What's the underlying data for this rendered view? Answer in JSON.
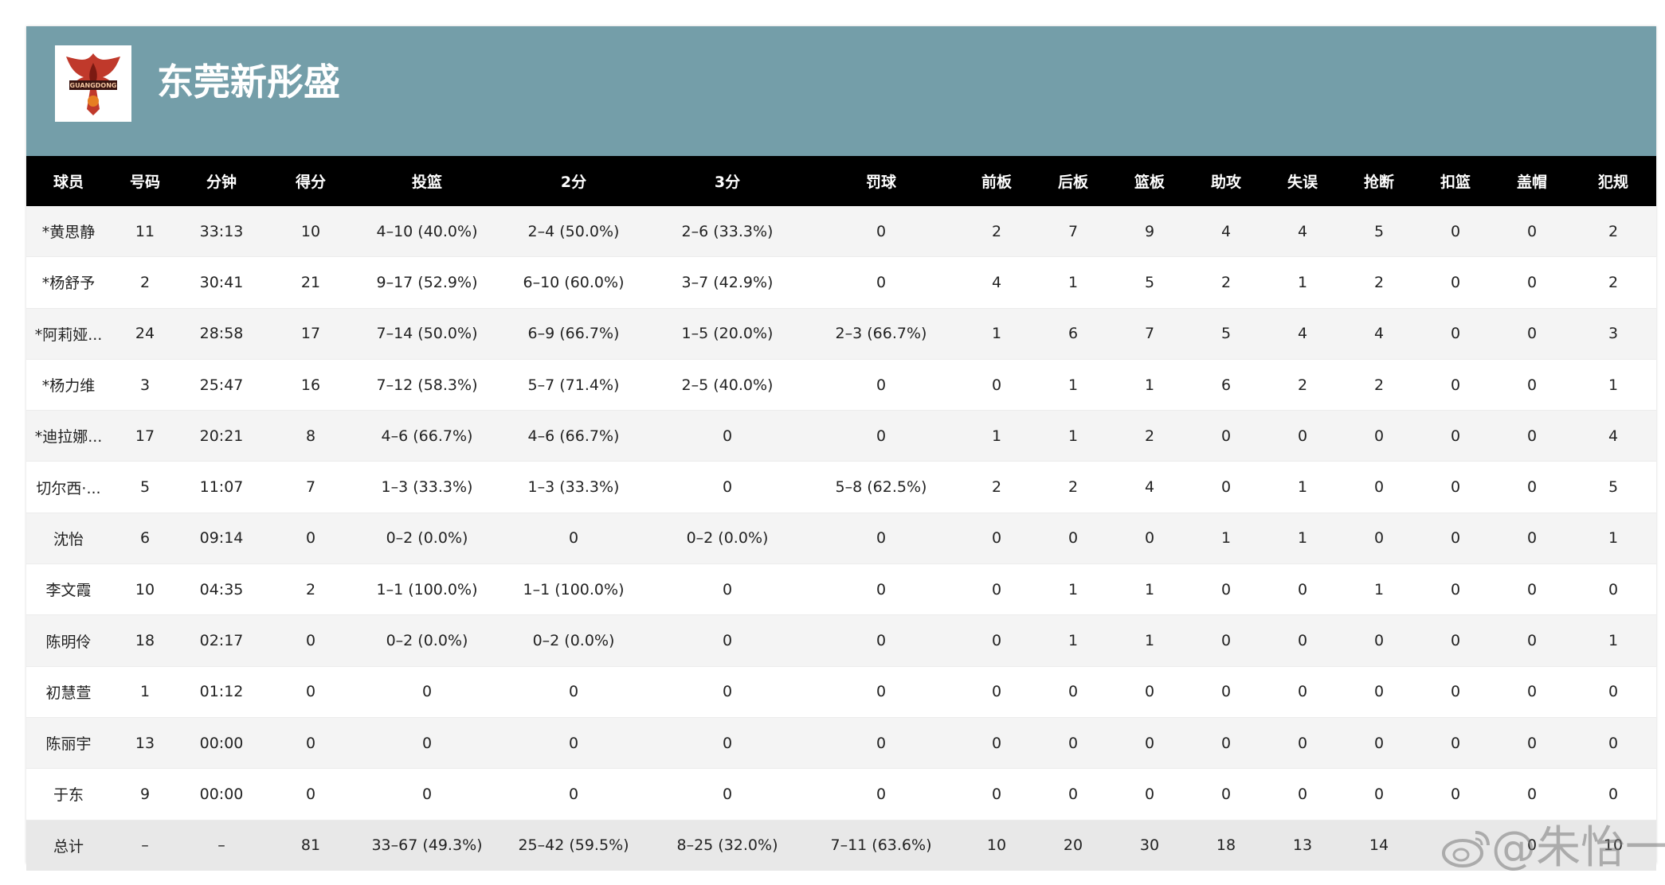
{
  "team": {
    "name": "东莞新彤盛",
    "logo_text": "GUANGDONG",
    "colors": {
      "header_bg": "#749ea9",
      "table_header_bg": "#000000",
      "logo_primary": "#c0392b"
    }
  },
  "table": {
    "columns": [
      "球员",
      "号码",
      "分钟",
      "得分",
      "投篮",
      "2分",
      "3分",
      "罚球",
      "前板",
      "后板",
      "篮板",
      "助攻",
      "失误",
      "抢断",
      "扣篮",
      "盖帽",
      "犯规"
    ],
    "rows": [
      [
        "*黄思静",
        "11",
        "33:13",
        "10",
        "4–10 (40.0%)",
        "2–4 (50.0%)",
        "2–6 (33.3%)",
        "0",
        "2",
        "7",
        "9",
        "4",
        "4",
        "5",
        "0",
        "0",
        "2"
      ],
      [
        "*杨舒予",
        "2",
        "30:41",
        "21",
        "9–17 (52.9%)",
        "6–10 (60.0%)",
        "3–7 (42.9%)",
        "0",
        "4",
        "1",
        "5",
        "2",
        "1",
        "2",
        "0",
        "0",
        "2"
      ],
      [
        "*阿莉娅...",
        "24",
        "28:58",
        "17",
        "7–14 (50.0%)",
        "6–9 (66.7%)",
        "1–5 (20.0%)",
        "2–3 (66.7%)",
        "1",
        "6",
        "7",
        "5",
        "4",
        "4",
        "0",
        "0",
        "3"
      ],
      [
        "*杨力维",
        "3",
        "25:47",
        "16",
        "7–12 (58.3%)",
        "5–7 (71.4%)",
        "2–5 (40.0%)",
        "0",
        "0",
        "1",
        "1",
        "6",
        "2",
        "2",
        "0",
        "0",
        "1"
      ],
      [
        "*迪拉娜...",
        "17",
        "20:21",
        "8",
        "4–6 (66.7%)",
        "4–6 (66.7%)",
        "0",
        "0",
        "1",
        "1",
        "2",
        "0",
        "0",
        "0",
        "0",
        "0",
        "4"
      ],
      [
        "切尔西·...",
        "5",
        "11:07",
        "7",
        "1–3 (33.3%)",
        "1–3 (33.3%)",
        "0",
        "5–8 (62.5%)",
        "2",
        "2",
        "4",
        "0",
        "1",
        "0",
        "0",
        "0",
        "5"
      ],
      [
        "沈怡",
        "6",
        "09:14",
        "0",
        "0–2 (0.0%)",
        "0",
        "0–2 (0.0%)",
        "0",
        "0",
        "0",
        "0",
        "1",
        "1",
        "0",
        "0",
        "0",
        "1"
      ],
      [
        "李文霞",
        "10",
        "04:35",
        "2",
        "1–1 (100.0%)",
        "1–1 (100.0%)",
        "0",
        "0",
        "0",
        "1",
        "1",
        "0",
        "0",
        "1",
        "0",
        "0",
        "0"
      ],
      [
        "陈明伶",
        "18",
        "02:17",
        "0",
        "0–2 (0.0%)",
        "0–2 (0.0%)",
        "0",
        "0",
        "0",
        "1",
        "1",
        "0",
        "0",
        "0",
        "0",
        "0",
        "1"
      ],
      [
        "初慧萱",
        "1",
        "01:12",
        "0",
        "0",
        "0",
        "0",
        "0",
        "0",
        "0",
        "0",
        "0",
        "0",
        "0",
        "0",
        "0",
        "0"
      ],
      [
        "陈丽宇",
        "13",
        "00:00",
        "0",
        "0",
        "0",
        "0",
        "0",
        "0",
        "0",
        "0",
        "0",
        "0",
        "0",
        "0",
        "0",
        "0"
      ],
      [
        "于东",
        "9",
        "00:00",
        "0",
        "0",
        "0",
        "0",
        "0",
        "0",
        "0",
        "0",
        "0",
        "0",
        "0",
        "0",
        "0",
        "0"
      ]
    ],
    "total": [
      "总计",
      "–",
      "–",
      "81",
      "33–67 (49.3%)",
      "25–42 (59.5%)",
      "8–25 (32.0%)",
      "7–11 (63.6%)",
      "10",
      "20",
      "30",
      "18",
      "13",
      "14",
      "",
      "0",
      "10"
    ]
  },
  "watermark": {
    "text": "@朱怡一",
    "icon": "weibo-icon"
  }
}
